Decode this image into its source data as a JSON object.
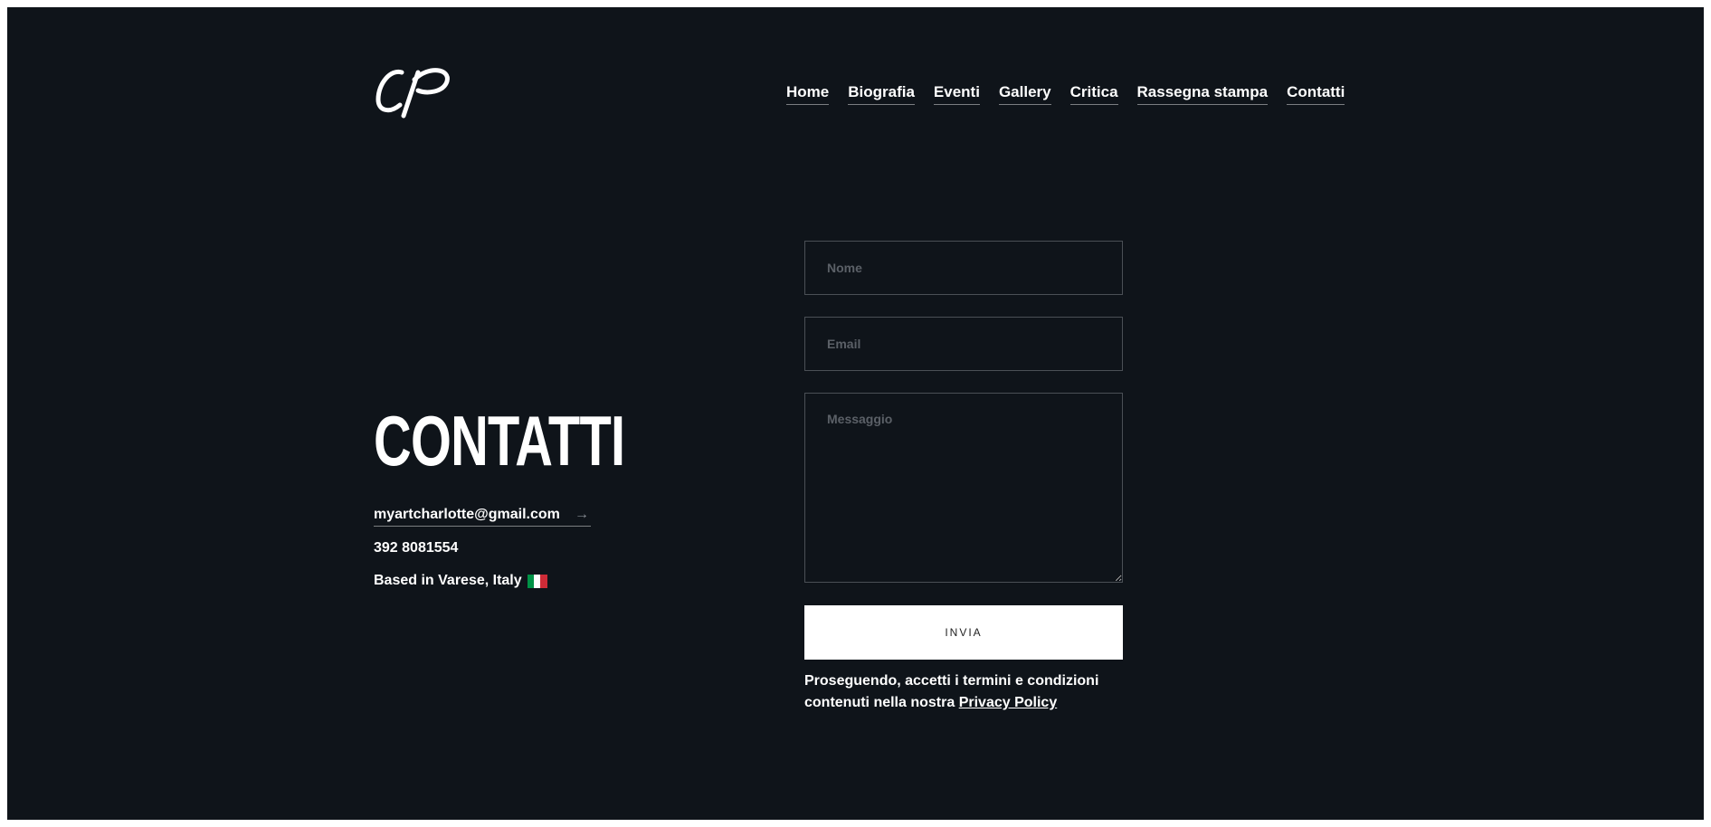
{
  "nav": {
    "items": [
      {
        "label": "Home"
      },
      {
        "label": "Biografia"
      },
      {
        "label": "Eventi"
      },
      {
        "label": "Gallery"
      },
      {
        "label": "Critica"
      },
      {
        "label": "Rassegna stampa"
      },
      {
        "label": "Contatti"
      }
    ]
  },
  "contact": {
    "title": "CONTATTI",
    "email": "myartcharlotte@gmail.com",
    "email_arrow": "→",
    "phone": "392 8081554",
    "location": "Based in Varese, Italy"
  },
  "form": {
    "name_placeholder": "Nome",
    "email_placeholder": "Email",
    "message_placeholder": "Messaggio",
    "submit_label": "INVIA",
    "disclaimer_text": "Proseguendo, accetti i termini e condizioni contenuti nella nostra",
    "privacy_link": "Privacy Policy"
  },
  "colors": {
    "background": "#0f141a",
    "text": "#ffffff",
    "flag_green": "#009246",
    "flag_white": "#ffffff",
    "flag_red": "#ce2b37"
  }
}
